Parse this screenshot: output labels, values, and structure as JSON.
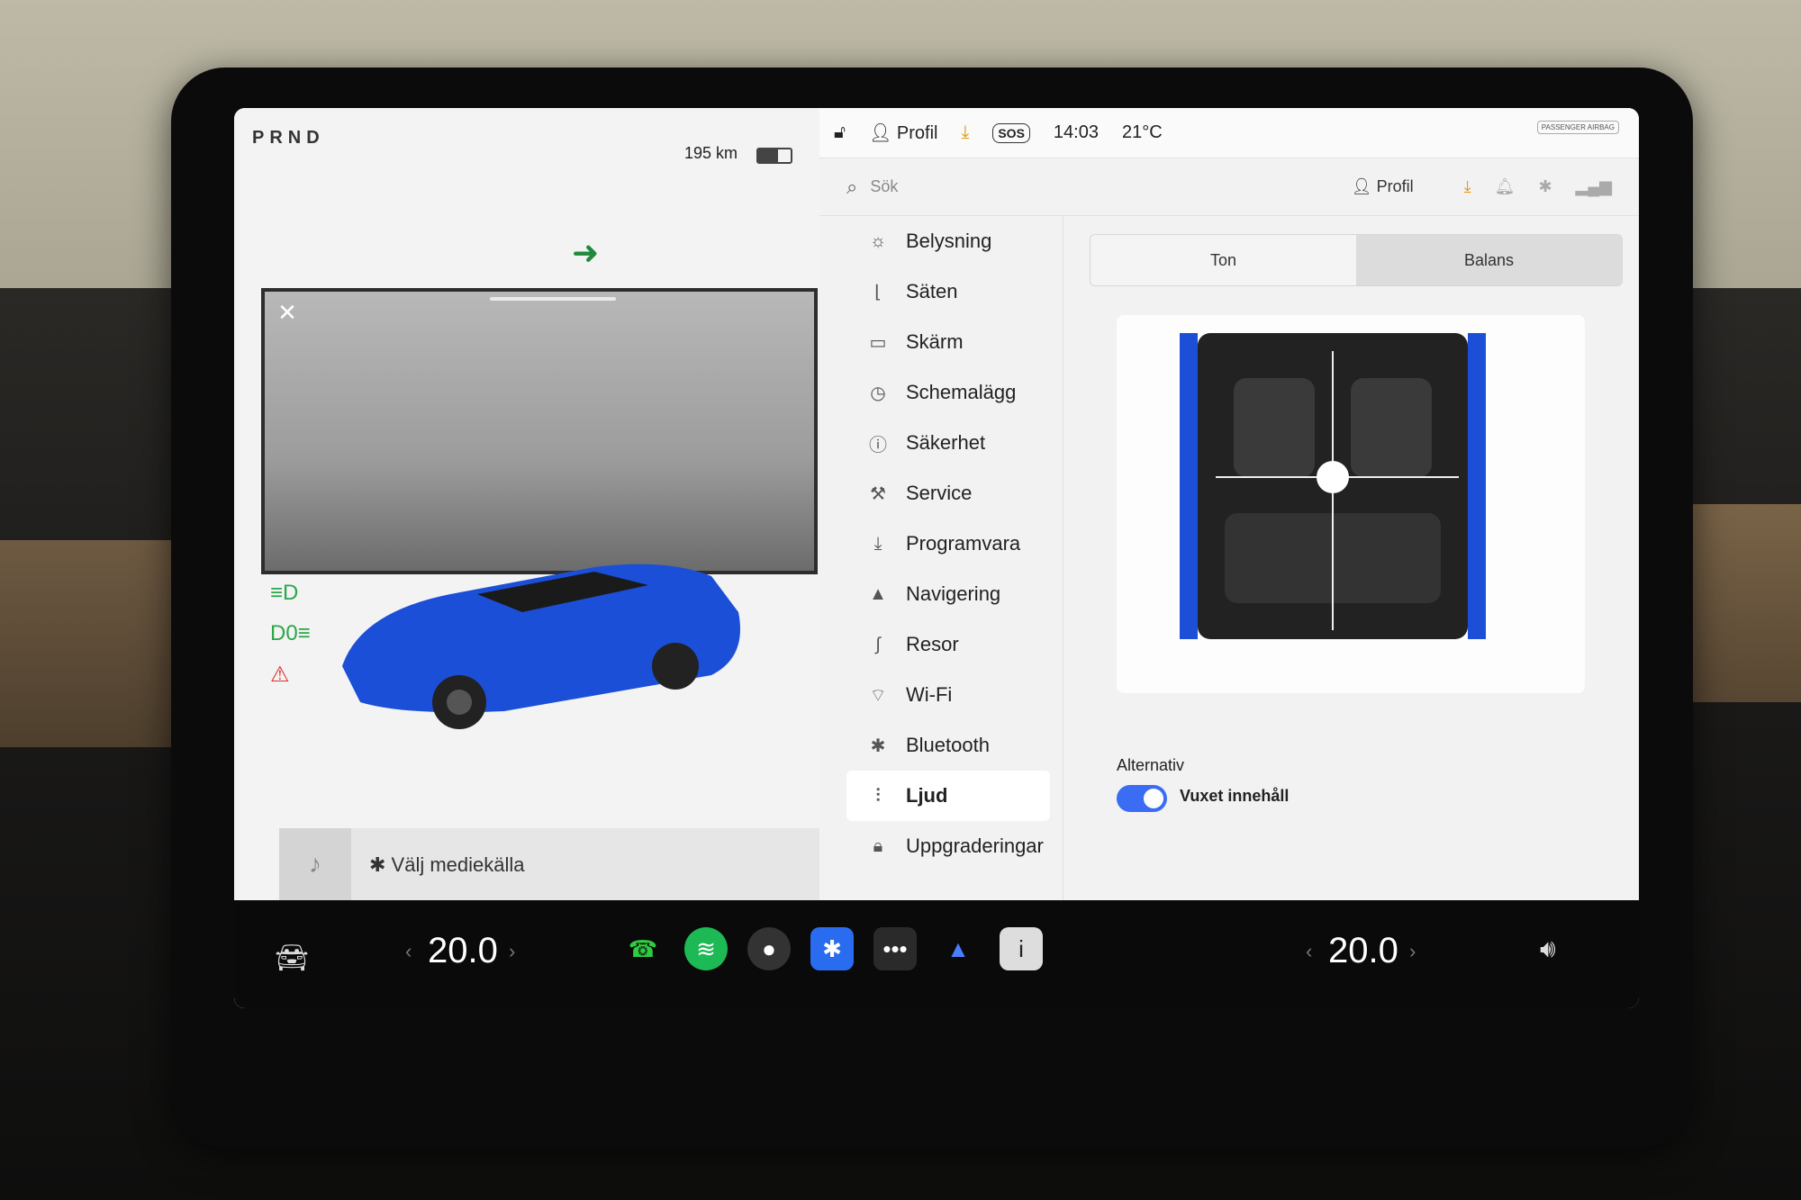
{
  "left_panel": {
    "prnd": "PRND",
    "range": "195 km",
    "battery_level": 0.6,
    "turn_arrow": "arrow-right",
    "camera": {
      "close_label": "✕"
    },
    "indicators": [
      "headlight-icon",
      "fog-light-icon",
      "seatbelt-warning-icon"
    ],
    "media": {
      "source_label": "Välj mediekälla",
      "controls": [
        "previous-icon",
        "play-icon",
        "next-icon",
        "equalizer-icon",
        "search-icon"
      ]
    }
  },
  "status_bar": {
    "profile": "Profil",
    "sos": "SOS",
    "time": "14:03",
    "temperature": "21°C",
    "airbag": "PASSENGER AIRBAG"
  },
  "search": {
    "placeholder": "Sök",
    "profile": "Profil"
  },
  "menu": {
    "items": [
      {
        "label": "Belysning",
        "icon": "light-icon"
      },
      {
        "label": "Säten",
        "icon": "seat-icon"
      },
      {
        "label": "Skärm",
        "icon": "display-icon"
      },
      {
        "label": "Schemalägg",
        "icon": "clock-icon"
      },
      {
        "label": "Säkerhet",
        "icon": "safety-icon"
      },
      {
        "label": "Service",
        "icon": "wrench-icon"
      },
      {
        "label": "Programvara",
        "icon": "download-icon"
      },
      {
        "label": "Navigering",
        "icon": "navigation-icon"
      },
      {
        "label": "Resor",
        "icon": "trips-icon"
      },
      {
        "label": "Wi-Fi",
        "icon": "wifi-icon"
      },
      {
        "label": "Bluetooth",
        "icon": "bluetooth-icon"
      },
      {
        "label": "Ljud",
        "icon": "sliders-icon",
        "active": true
      },
      {
        "label": "Uppgraderingar",
        "icon": "lock-icon"
      }
    ]
  },
  "audio": {
    "tabs": [
      "Ton",
      "Balans"
    ],
    "active_tab": "Balans",
    "options_label": "Alternativ",
    "mature_content_label": "Vuxet innehåll",
    "mature_content_enabled": true
  },
  "dock": {
    "left_temp": "20.0",
    "right_temp": "20.0",
    "apps": [
      "phone-icon",
      "spotify-icon",
      "camera-icon",
      "bluetooth-icon",
      "more-icon",
      "navigation-app-icon",
      "info-icon"
    ]
  },
  "colors": {
    "accent_blue": "#3a6cf4",
    "car_blue": "#1b4fd8",
    "download_orange": "#e59400",
    "turn_green": "#1f8a3a"
  }
}
